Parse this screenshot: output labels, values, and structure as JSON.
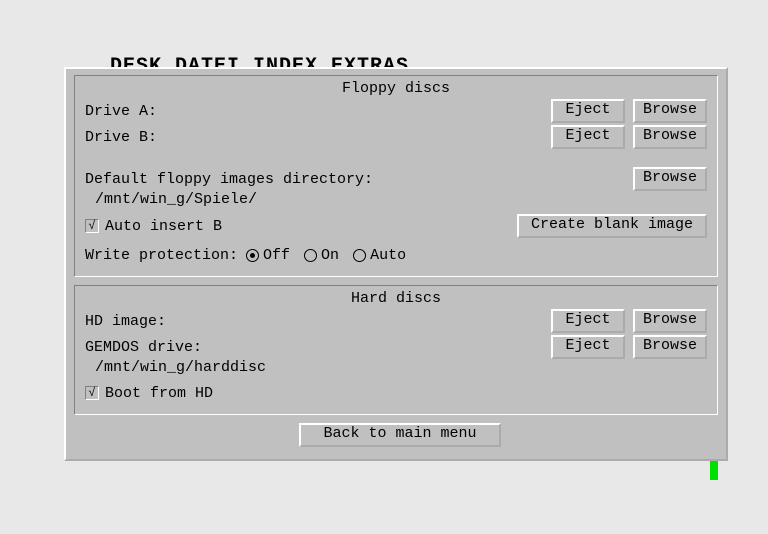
{
  "background_menu": "DESK  DATEI  INDEX  EXTRAS",
  "floppy": {
    "title": "Floppy discs",
    "drive_a_label": "Drive A:",
    "drive_b_label": "Drive B:",
    "eject": "Eject",
    "browse": "Browse",
    "default_dir_label": "Default floppy images directory:",
    "default_dir_path": "/mnt/win_g/Spiele/",
    "auto_insert_label": "Auto insert B",
    "auto_insert_checked": "√",
    "create_blank": "Create blank image",
    "write_prot_label": "Write protection:",
    "wp_off": "Off",
    "wp_on": "On",
    "wp_auto": "Auto",
    "wp_selected": "off"
  },
  "hard": {
    "title": "Hard discs",
    "hd_image_label": "HD image:",
    "gemdos_label": "GEMDOS drive:",
    "gemdos_path": "/mnt/win_g/harddisc",
    "eject": "Eject",
    "browse": "Browse",
    "boot_label": "Boot from HD",
    "boot_checked": "√"
  },
  "back_button": "Back to main menu"
}
